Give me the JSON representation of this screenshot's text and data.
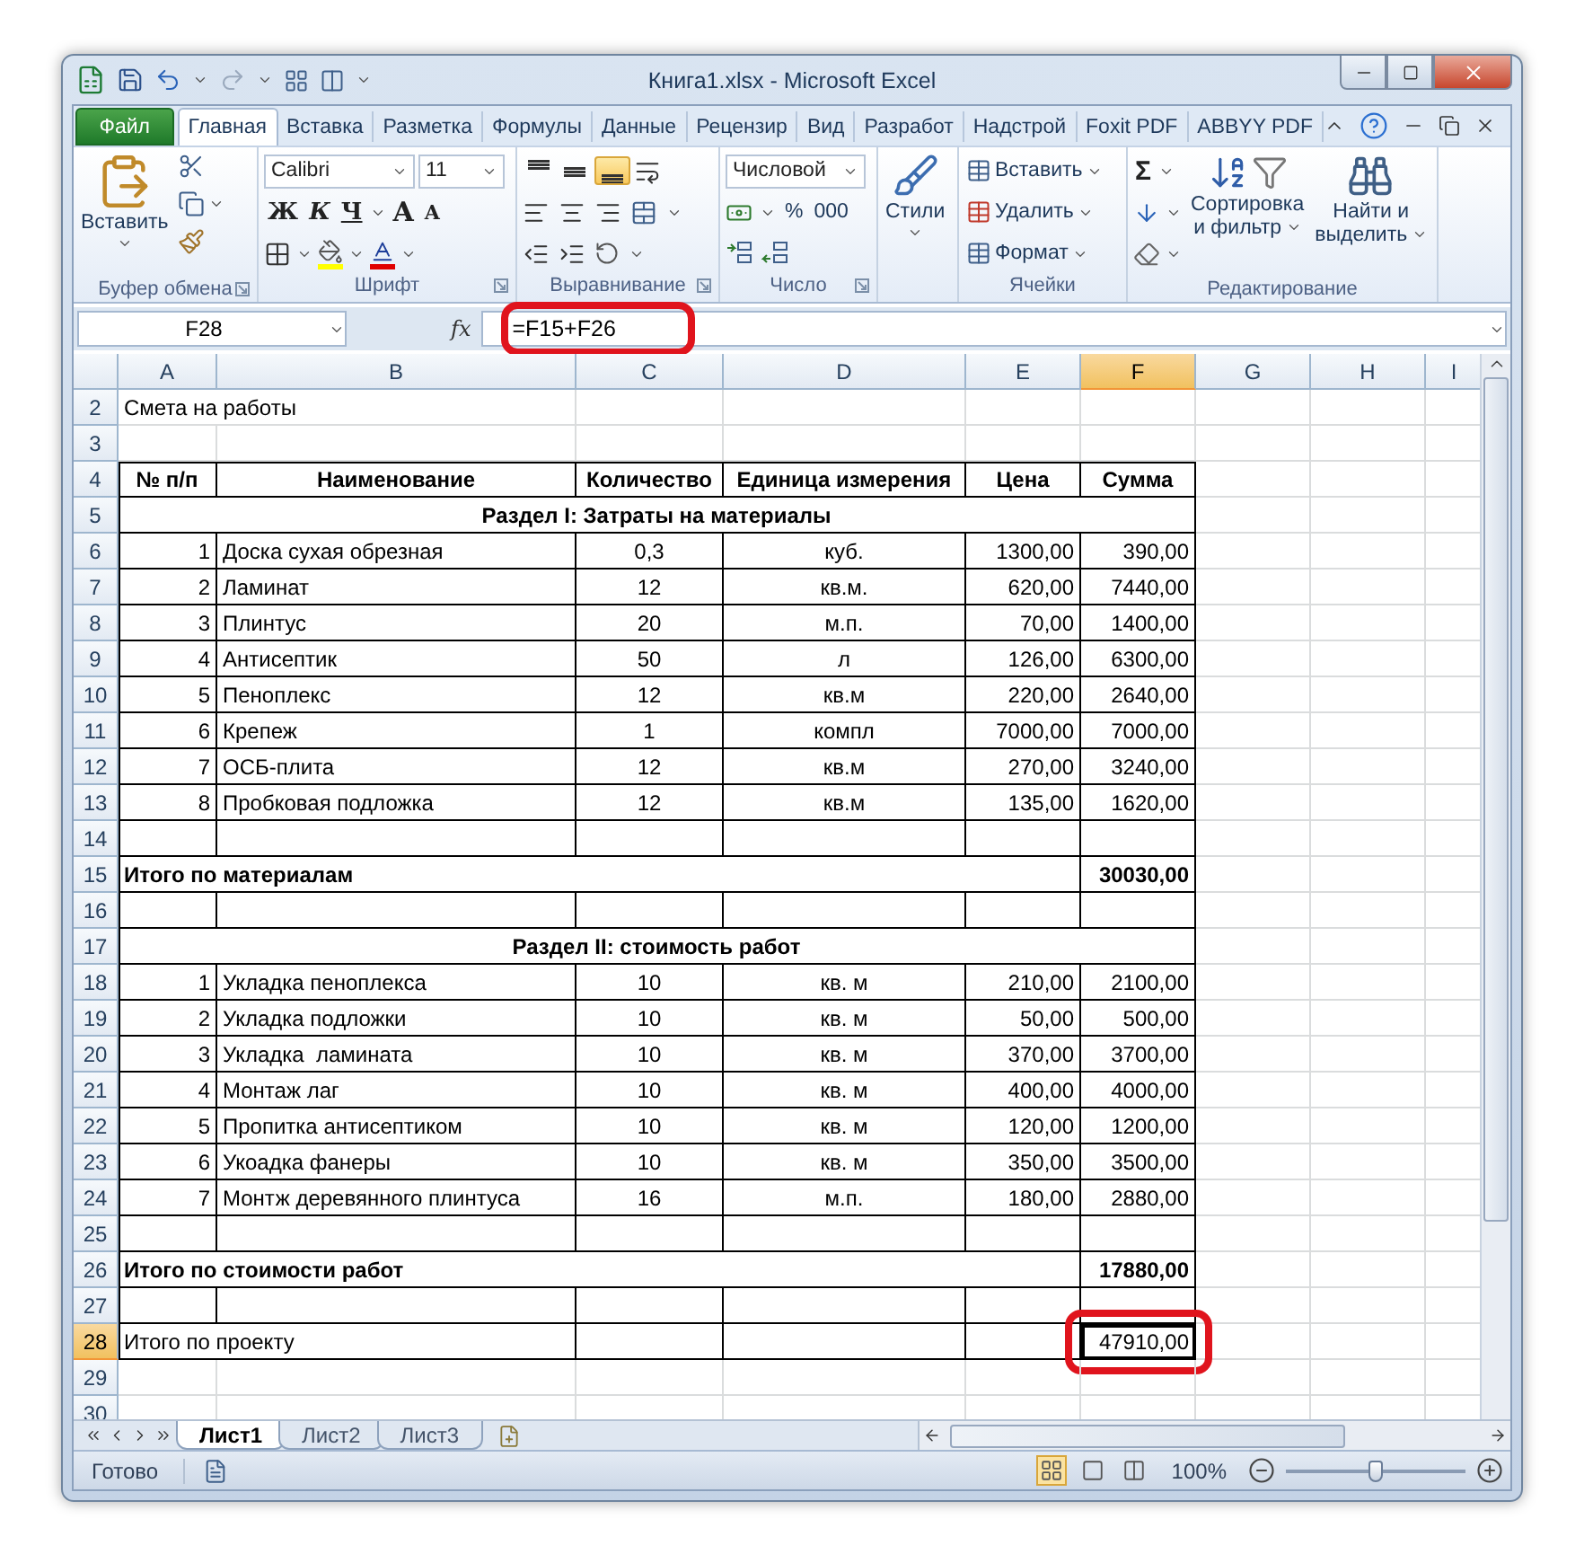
{
  "window": {
    "title": "Книга1.xlsx - Microsoft Excel"
  },
  "tabs": [
    {
      "label": "Файл",
      "kind": "file",
      "selected": false
    },
    {
      "label": "Главная",
      "kind": "tab",
      "selected": true
    },
    {
      "label": "Вставка",
      "kind": "tab",
      "selected": false
    },
    {
      "label": "Разметка",
      "kind": "tab",
      "selected": false
    },
    {
      "label": "Формулы",
      "kind": "tab",
      "selected": false
    },
    {
      "label": "Данные",
      "kind": "tab",
      "selected": false
    },
    {
      "label": "Рецензир",
      "kind": "tab",
      "selected": false
    },
    {
      "label": "Вид",
      "kind": "tab",
      "selected": false
    },
    {
      "label": "Разработ",
      "kind": "tab",
      "selected": false
    },
    {
      "label": "Надстрой",
      "kind": "tab",
      "selected": false
    },
    {
      "label": "Foxit PDF",
      "kind": "tab",
      "selected": false
    },
    {
      "label": "ABBYY PDF",
      "kind": "tab",
      "selected": false
    }
  ],
  "ribbon": {
    "clipboard": {
      "paste": "Вставить",
      "label": "Буфер обмена"
    },
    "font": {
      "name": "Calibri",
      "size": "11",
      "styles": [
        "Ж",
        "К",
        "Ч"
      ],
      "grow": "A",
      "shrink": "A",
      "label": "Шрифт"
    },
    "alignment": {
      "label": "Выравнивание",
      "vertical": [
        {
          "selected": false
        },
        {
          "selected": false
        },
        {
          "selected": true
        }
      ]
    },
    "number": {
      "format": "Числовой",
      "percent": "%",
      "thousands": "000",
      "label": "Число"
    },
    "styles": {
      "button": "Стили"
    },
    "cells": {
      "items": [
        "Вставить",
        "Удалить",
        "Формат"
      ],
      "label": "Ячейки"
    },
    "editing": {
      "sum": "Σ",
      "sort": [
        "Сортировка",
        "и фильтр"
      ],
      "find": [
        "Найти и",
        "выделить"
      ],
      "label": "Редактирование"
    }
  },
  "formula_bar": {
    "name_box": "F28",
    "fx": "fx",
    "formula": "=F15+F26",
    "highlighted": true
  },
  "columns": [
    {
      "label": "A",
      "selected": false
    },
    {
      "label": "B",
      "selected": false
    },
    {
      "label": "C",
      "selected": false
    },
    {
      "label": "D",
      "selected": false
    },
    {
      "label": "E",
      "selected": false
    },
    {
      "label": "F",
      "selected": true
    },
    {
      "label": "G",
      "selected": false
    },
    {
      "label": "H",
      "selected": false
    },
    {
      "label": "I",
      "selected": false
    }
  ],
  "rows": [
    {
      "number": "2",
      "kind": "title",
      "selected": false,
      "cells": [
        "Смета на работы"
      ]
    },
    {
      "number": "3",
      "kind": "empty",
      "selected": false
    },
    {
      "number": "4",
      "kind": "header",
      "selected": false,
      "cells": [
        "№ п/п",
        "Наименование",
        "Количество",
        "Единица измерения",
        "Цена",
        "Сумма"
      ]
    },
    {
      "number": "5",
      "kind": "section",
      "selected": false,
      "cells": [
        "Раздел I: Затраты на материалы"
      ]
    },
    {
      "number": "6",
      "kind": "item",
      "selected": false,
      "cells": [
        "1",
        "Доска сухая обрезная",
        "0,3",
        "куб.",
        "1300,00",
        "390,00"
      ]
    },
    {
      "number": "7",
      "kind": "item",
      "selected": false,
      "cells": [
        "2",
        "Ламинат",
        "12",
        "кв.м.",
        "620,00",
        "7440,00"
      ]
    },
    {
      "number": "8",
      "kind": "item",
      "selected": false,
      "cells": [
        "3",
        "Плинтус",
        "20",
        "м.п.",
        "70,00",
        "1400,00"
      ]
    },
    {
      "number": "9",
      "kind": "item",
      "selected": false,
      "cells": [
        "4",
        "Антисептик",
        "50",
        "л",
        "126,00",
        "6300,00"
      ]
    },
    {
      "number": "10",
      "kind": "item",
      "selected": false,
      "cells": [
        "5",
        "Пеноплекс",
        "12",
        "кв.м",
        "220,00",
        "2640,00"
      ]
    },
    {
      "number": "11",
      "kind": "item",
      "selected": false,
      "cells": [
        "6",
        "Крепеж",
        "1",
        "компл",
        "7000,00",
        "7000,00"
      ]
    },
    {
      "number": "12",
      "kind": "item",
      "selected": false,
      "cells": [
        "7",
        "ОСБ-плита",
        "12",
        "кв.м",
        "270,00",
        "3240,00"
      ]
    },
    {
      "number": "13",
      "kind": "item",
      "selected": false,
      "cells": [
        "8",
        "Пробковая подложка",
        "12",
        "кв.м",
        "135,00",
        "1620,00"
      ]
    },
    {
      "number": "14",
      "kind": "blank",
      "selected": false
    },
    {
      "number": "15",
      "kind": "total",
      "selected": false,
      "cells": [
        "Итого по материалам",
        "30030,00"
      ]
    },
    {
      "number": "16",
      "kind": "blank",
      "selected": false
    },
    {
      "number": "17",
      "kind": "section",
      "selected": false,
      "cells": [
        "Раздел II: стоимость работ"
      ]
    },
    {
      "number": "18",
      "kind": "item",
      "selected": false,
      "cells": [
        "1",
        "Укладка пеноплекса",
        "10",
        "кв. м",
        "210,00",
        "2100,00"
      ]
    },
    {
      "number": "19",
      "kind": "item",
      "selected": false,
      "cells": [
        "2",
        "Укладка подложки",
        "10",
        "кв. м",
        "50,00",
        "500,00"
      ]
    },
    {
      "number": "20",
      "kind": "item",
      "selected": false,
      "cells": [
        "3",
        "Укладка  ламината",
        "10",
        "кв. м",
        "370,00",
        "3700,00"
      ]
    },
    {
      "number": "21",
      "kind": "item",
      "selected": false,
      "cells": [
        "4",
        "Монтаж лаг",
        "10",
        "кв. м",
        "400,00",
        "4000,00"
      ]
    },
    {
      "number": "22",
      "kind": "item",
      "selected": false,
      "cells": [
        "5",
        "Пропитка антисептиком",
        "10",
        "кв. м",
        "120,00",
        "1200,00"
      ]
    },
    {
      "number": "23",
      "kind": "item",
      "selected": false,
      "cells": [
        "6",
        "Укоадка фанеры",
        "10",
        "кв. м",
        "350,00",
        "3500,00"
      ]
    },
    {
      "number": "24",
      "kind": "item",
      "selected": false,
      "cells": [
        "7",
        "Монтж деревянного плинтуса",
        "16",
        "м.п.",
        "180,00",
        "2880,00"
      ]
    },
    {
      "number": "25",
      "kind": "blank",
      "selected": false
    },
    {
      "number": "26",
      "kind": "total",
      "selected": false,
      "cells": [
        "Итого по стоимости работ",
        "17880,00"
      ]
    },
    {
      "number": "27",
      "kind": "blank",
      "selected": false
    },
    {
      "number": "28",
      "kind": "grand",
      "selected": true,
      "highlighted": true,
      "cells": [
        "Итого по проекту",
        "47910,00"
      ]
    },
    {
      "number": "29",
      "kind": "empty",
      "selected": false
    },
    {
      "number": "30",
      "kind": "empty",
      "selected": false
    }
  ],
  "sheets": [
    {
      "label": "Лист1",
      "selected": true
    },
    {
      "label": "Лист2",
      "selected": false
    },
    {
      "label": "Лист3",
      "selected": false
    }
  ],
  "status_bar": {
    "mode": "Готово",
    "zoom": "100%",
    "zoom_slider": {
      "level": 0.5
    }
  }
}
